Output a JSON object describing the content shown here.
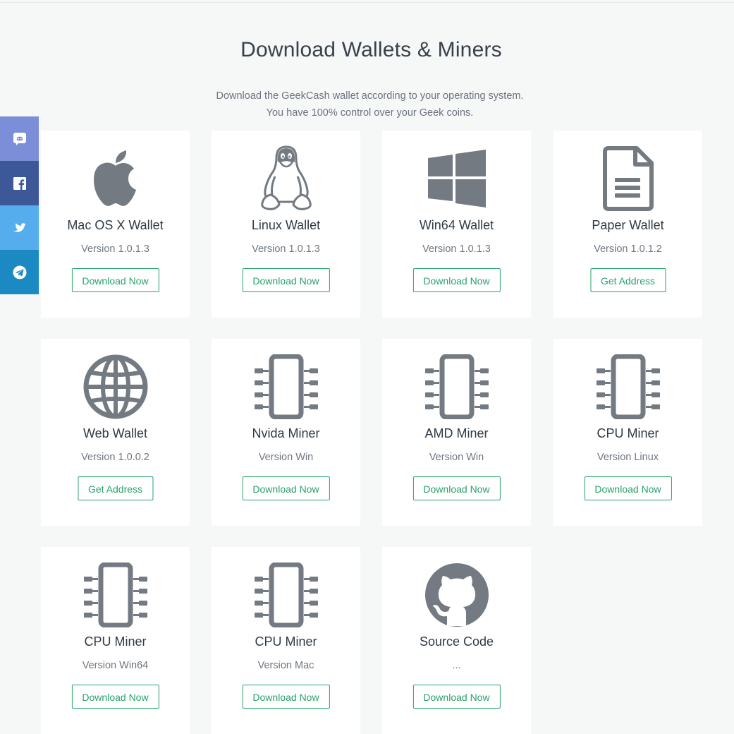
{
  "header": {
    "title": "Download Wallets & Miners",
    "subtitle_line1": "Download the GeekCash wallet according to your operating system.",
    "subtitle_line2": "You have 100% control over your Geek coins."
  },
  "social": [
    {
      "name": "discord",
      "icon": "discord-icon",
      "color": "#7d8ed8"
    },
    {
      "name": "facebook",
      "icon": "facebook-icon",
      "color": "#3c5898"
    },
    {
      "name": "twitter",
      "icon": "twitter-icon",
      "color": "#55adee"
    },
    {
      "name": "telegram",
      "icon": "telegram-icon",
      "color": "#1b8ac3"
    }
  ],
  "accent_color": "#27a36a",
  "icon_color": "#737a82",
  "cards": [
    {
      "title": "Mac OS X Wallet",
      "version": "Version 1.0.1.3",
      "button": "Download Now",
      "icon": "apple-icon"
    },
    {
      "title": "Linux Wallet",
      "version": "Version 1.0.1.3",
      "button": "Download Now",
      "icon": "linux-icon"
    },
    {
      "title": "Win64 Wallet",
      "version": "Version 1.0.1.3",
      "button": "Download Now",
      "icon": "windows-icon"
    },
    {
      "title": "Paper Wallet",
      "version": "Version 1.0.1.2",
      "button": "Get Address",
      "icon": "document-icon"
    },
    {
      "title": "Web Wallet",
      "version": "Version 1.0.0.2",
      "button": "Get Address",
      "icon": "globe-icon"
    },
    {
      "title": "Nvida Miner",
      "version": "Version Win",
      "button": "Download Now",
      "icon": "chip-icon"
    },
    {
      "title": "AMD Miner",
      "version": "Version Win",
      "button": "Download Now",
      "icon": "chip-icon"
    },
    {
      "title": "CPU Miner",
      "version": "Version Linux",
      "button": "Download Now",
      "icon": "chip-icon"
    },
    {
      "title": "CPU Miner",
      "version": "Version Win64",
      "button": "Download Now",
      "icon": "chip-icon"
    },
    {
      "title": "CPU Miner",
      "version": "Version Mac",
      "button": "Download Now",
      "icon": "chip-icon"
    },
    {
      "title": "Source Code",
      "version": "...",
      "button": "Download Now",
      "icon": "github-icon"
    }
  ]
}
